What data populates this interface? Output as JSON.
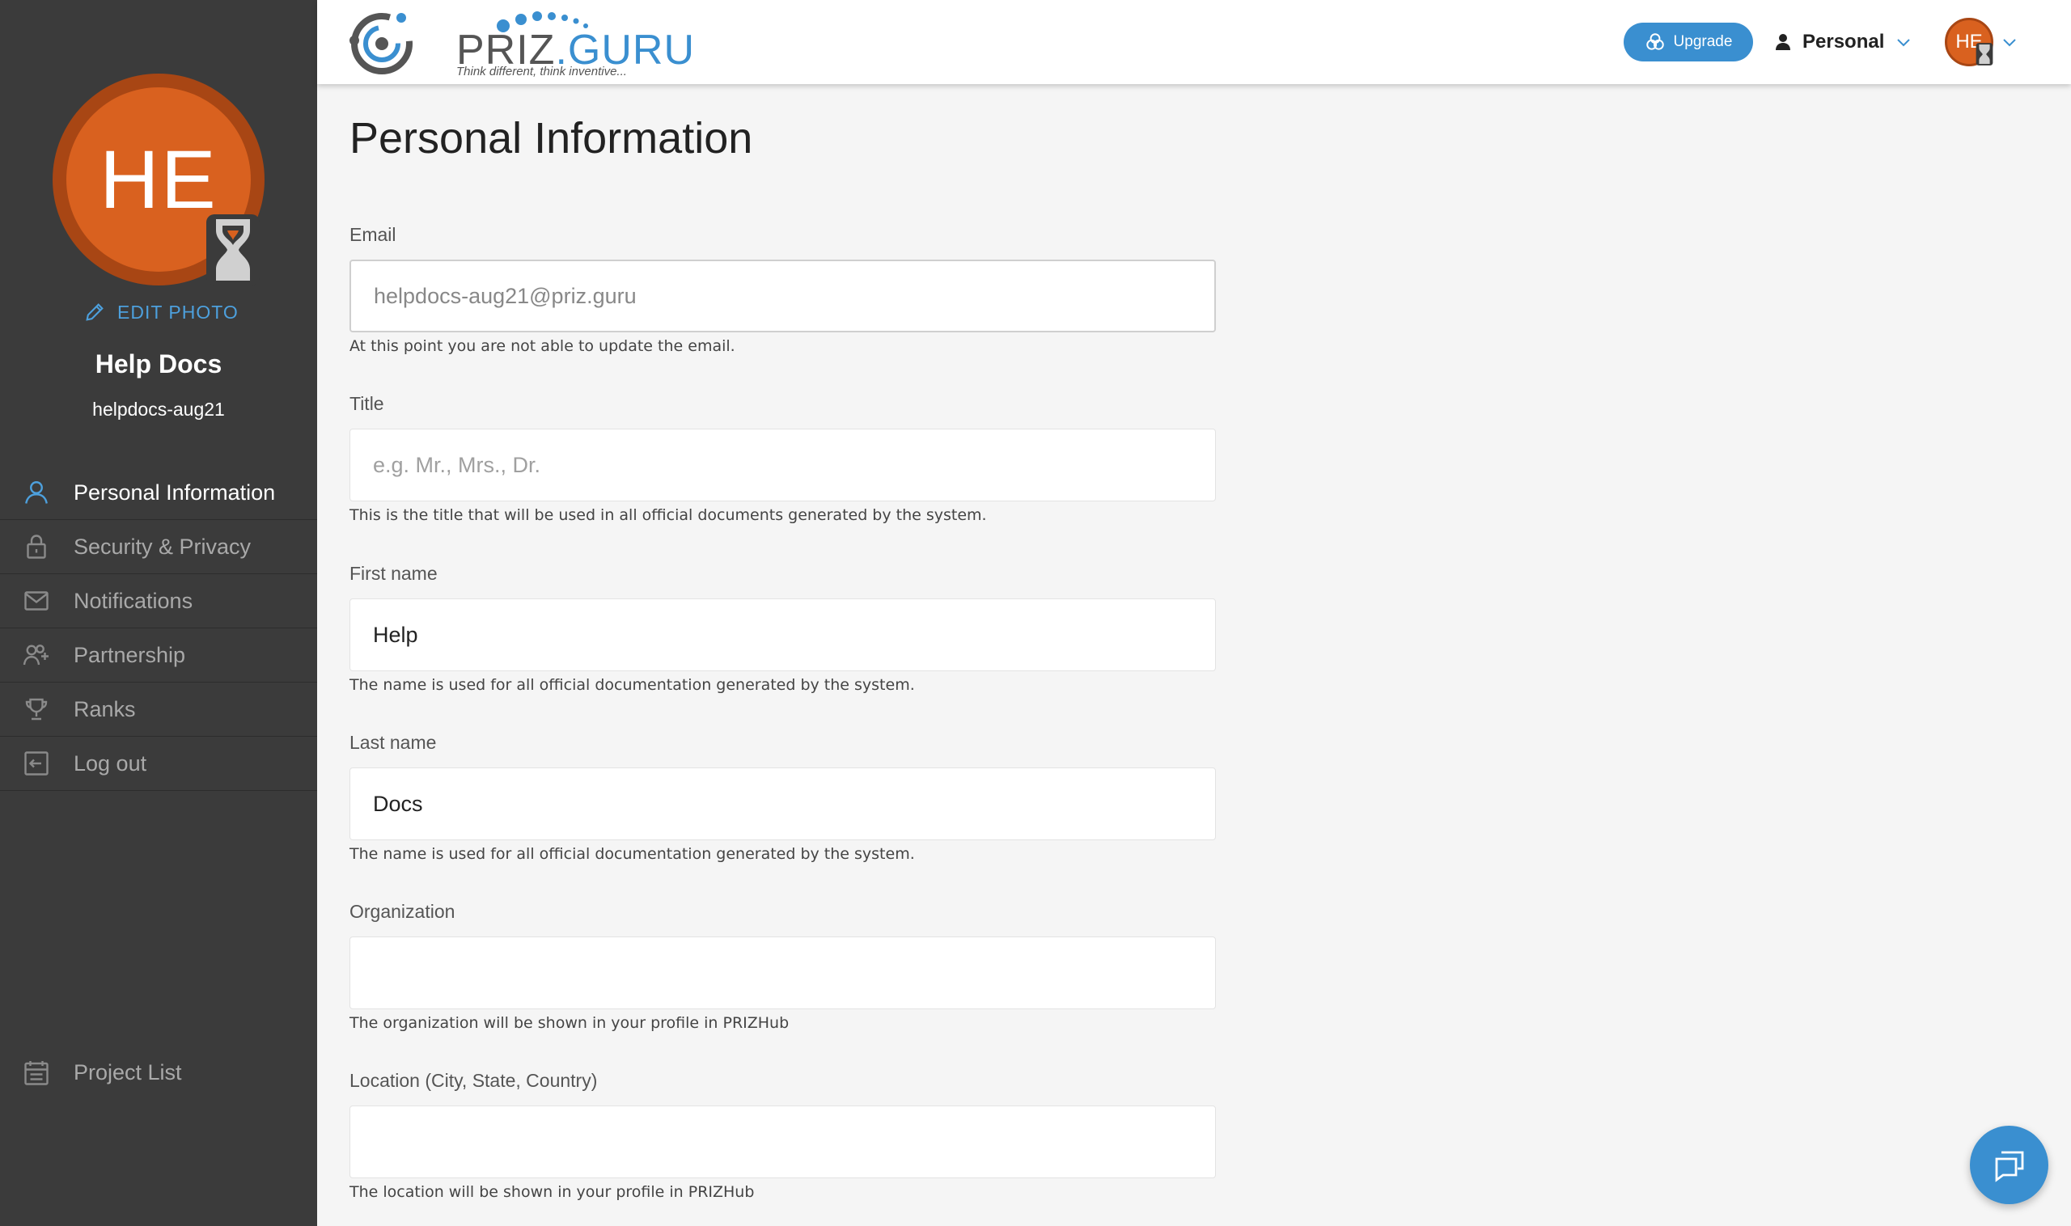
{
  "sidebar": {
    "avatar_initials": "HE",
    "edit_photo_label": "EDIT PHOTO",
    "user_name": "Help Docs",
    "user_handle": "helpdocs-aug21",
    "nav": [
      {
        "label": "Personal Information",
        "icon": "user-icon",
        "active": true
      },
      {
        "label": "Security & Privacy",
        "icon": "lock-icon",
        "active": false
      },
      {
        "label": "Notifications",
        "icon": "mail-icon",
        "active": false
      },
      {
        "label": "Partnership",
        "icon": "users-plus-icon",
        "active": false
      },
      {
        "label": "Ranks",
        "icon": "trophy-icon",
        "active": false
      },
      {
        "label": "Log out",
        "icon": "logout-icon",
        "active": false
      }
    ],
    "project_list_label": "Project List"
  },
  "header": {
    "logo_main": "PRIZ",
    "logo_accent": ".GURU",
    "logo_tagline": "Think different, think inventive...",
    "upgrade_label": "Upgrade",
    "workspace_label": "Personal",
    "avatar_initials": "HE"
  },
  "page": {
    "title": "Personal Information",
    "fields": {
      "email": {
        "label": "Email",
        "value": "helpdocs-aug21@priz.guru",
        "help": "At this point you are not able to update the email."
      },
      "title": {
        "label": "Title",
        "placeholder": "e.g. Mr., Mrs., Dr.",
        "value": "",
        "help": "This is the title that will be used in all official documents generated by the system."
      },
      "first_name": {
        "label": "First name",
        "value": "Help",
        "help": "The name is used for all official documentation generated by the system."
      },
      "last_name": {
        "label": "Last name",
        "value": "Docs",
        "help": "The name is used for all official documentation generated by the system."
      },
      "organization": {
        "label": "Organization",
        "value": "",
        "help": "The organization will be shown in your profile in PRIZHub"
      },
      "location": {
        "label": "Location (City, State, Country)",
        "value": "",
        "help": "The location will be shown in your profile in PRIZHub"
      }
    }
  },
  "colors": {
    "sidebar_bg": "#3b3b3b",
    "accent_blue": "#3a8fd0",
    "avatar_orange": "#d9611f"
  }
}
